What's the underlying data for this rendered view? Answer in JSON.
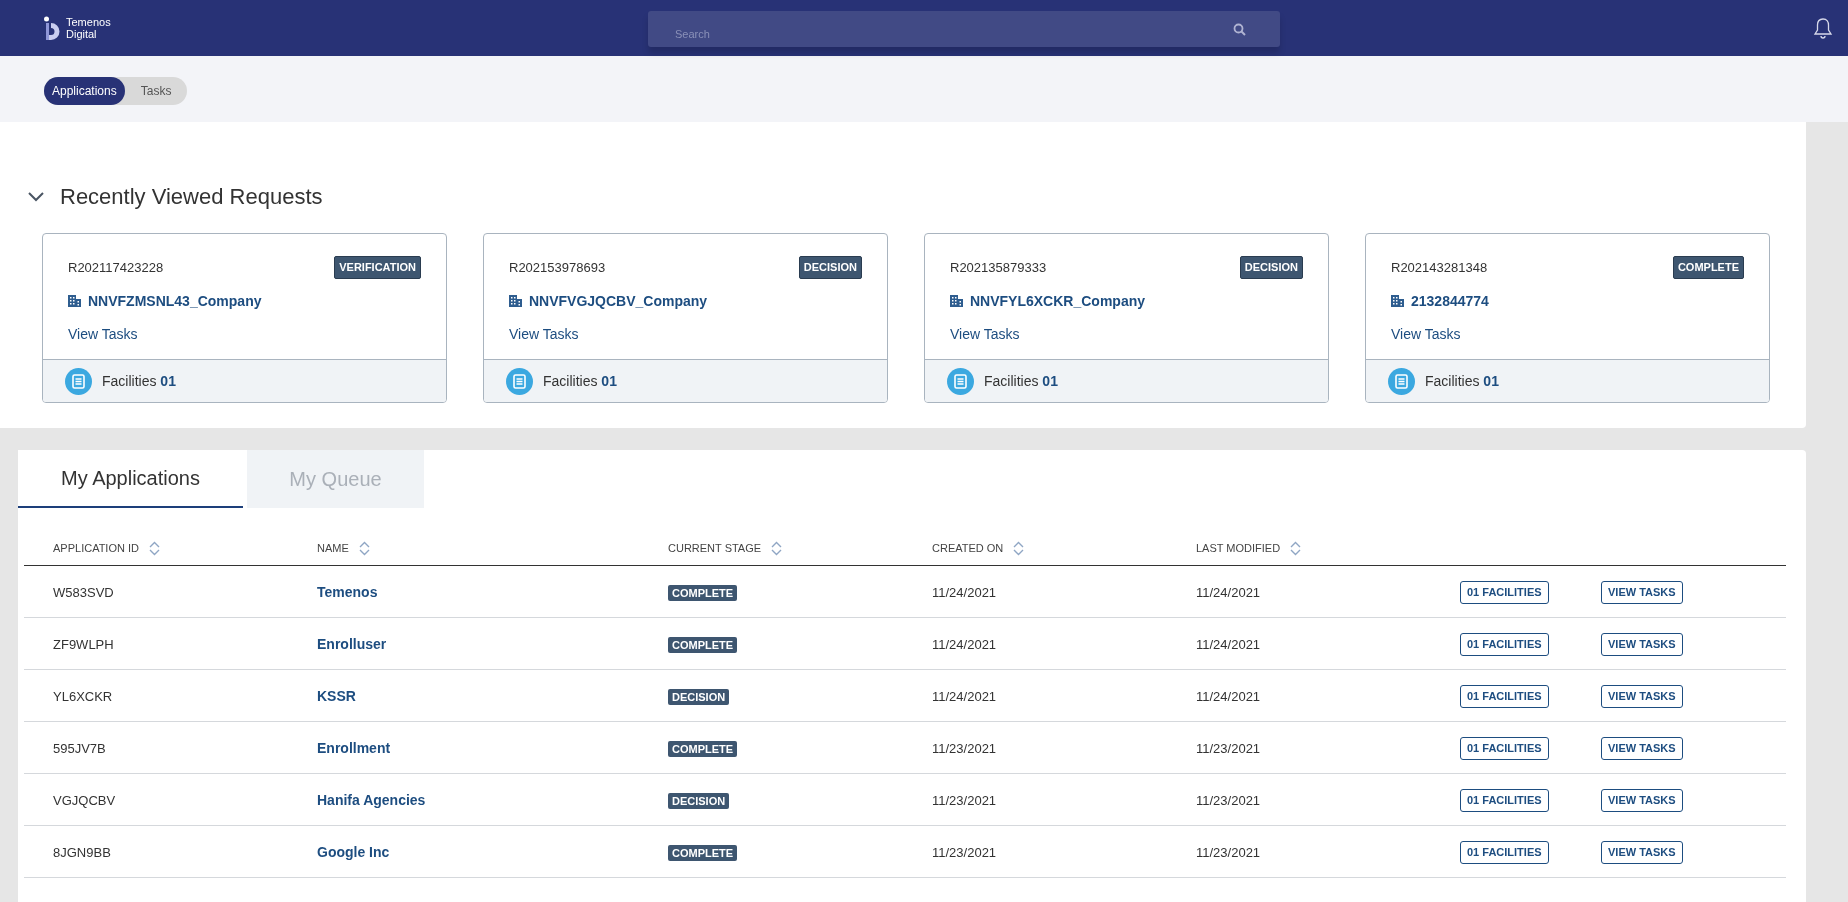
{
  "header": {
    "logo_lines": [
      "Temenos",
      "Digital"
    ],
    "search": {
      "placeholder": "Search"
    }
  },
  "view_toggle": [
    {
      "label": "Applications",
      "selected": true
    },
    {
      "label": "Tasks",
      "selected": false
    }
  ],
  "recent": {
    "title": "Recently Viewed Requests",
    "expanded": true,
    "cards": [
      {
        "request_id": "R202117423228",
        "stage": "VERIFICATION",
        "customer": "NNVFZMSNL43_Company",
        "link": "View Tasks",
        "facilities_label": "Facilities",
        "facilities_count": "01"
      },
      {
        "request_id": "R202153978693",
        "stage": "DECISION",
        "customer": "NNVFVGJQCBV_Company",
        "link": "View Tasks",
        "facilities_label": "Facilities",
        "facilities_count": "01"
      },
      {
        "request_id": "R202135879333",
        "stage": "DECISION",
        "customer": "NNVFYL6XCKR_Company",
        "link": "View Tasks",
        "facilities_label": "Facilities",
        "facilities_count": "01"
      },
      {
        "request_id": "R202143281348",
        "stage": "COMPLETE",
        "customer": "2132844774",
        "link": "View Tasks",
        "facilities_label": "Facilities",
        "facilities_count": "01"
      }
    ]
  },
  "tabs": [
    {
      "label": "My Applications",
      "selected": true
    },
    {
      "label": "My Queue",
      "selected": false
    }
  ],
  "table": {
    "columns": [
      "APPLICATION ID",
      "NAME",
      "CURRENT STAGE",
      "CREATED ON",
      "LAST MODIFIED"
    ],
    "rows": [
      {
        "id": "W583SVD",
        "name": "Temenos",
        "stage": "COMPLETE",
        "created": "11/24/2021",
        "modified": "11/24/2021",
        "facilities": "01 FACILITIES",
        "tasks": "VIEW TASKS"
      },
      {
        "id": "ZF9WLPH",
        "name": "Enrolluser",
        "stage": "COMPLETE",
        "created": "11/24/2021",
        "modified": "11/24/2021",
        "facilities": "01 FACILITIES",
        "tasks": "VIEW TASKS"
      },
      {
        "id": "YL6XCKR",
        "name": "KSSR",
        "stage": "DECISION",
        "created": "11/24/2021",
        "modified": "11/24/2021",
        "facilities": "01 FACILITIES",
        "tasks": "VIEW TASKS"
      },
      {
        "id": "595JV7B",
        "name": "Enrollment",
        "stage": "COMPLETE",
        "created": "11/23/2021",
        "modified": "11/23/2021",
        "facilities": "01 FACILITIES",
        "tasks": "VIEW TASKS"
      },
      {
        "id": "VGJQCBV",
        "name": "Hanifa Agencies",
        "stage": "DECISION",
        "created": "11/23/2021",
        "modified": "11/23/2021",
        "facilities": "01 FACILITIES",
        "tasks": "VIEW TASKS"
      },
      {
        "id": "8JGN9BB",
        "name": "Google Inc",
        "stage": "COMPLETE",
        "created": "11/23/2021",
        "modified": "11/23/2021",
        "facilities": "01 FACILITIES",
        "tasks": "VIEW TASKS"
      }
    ]
  }
}
